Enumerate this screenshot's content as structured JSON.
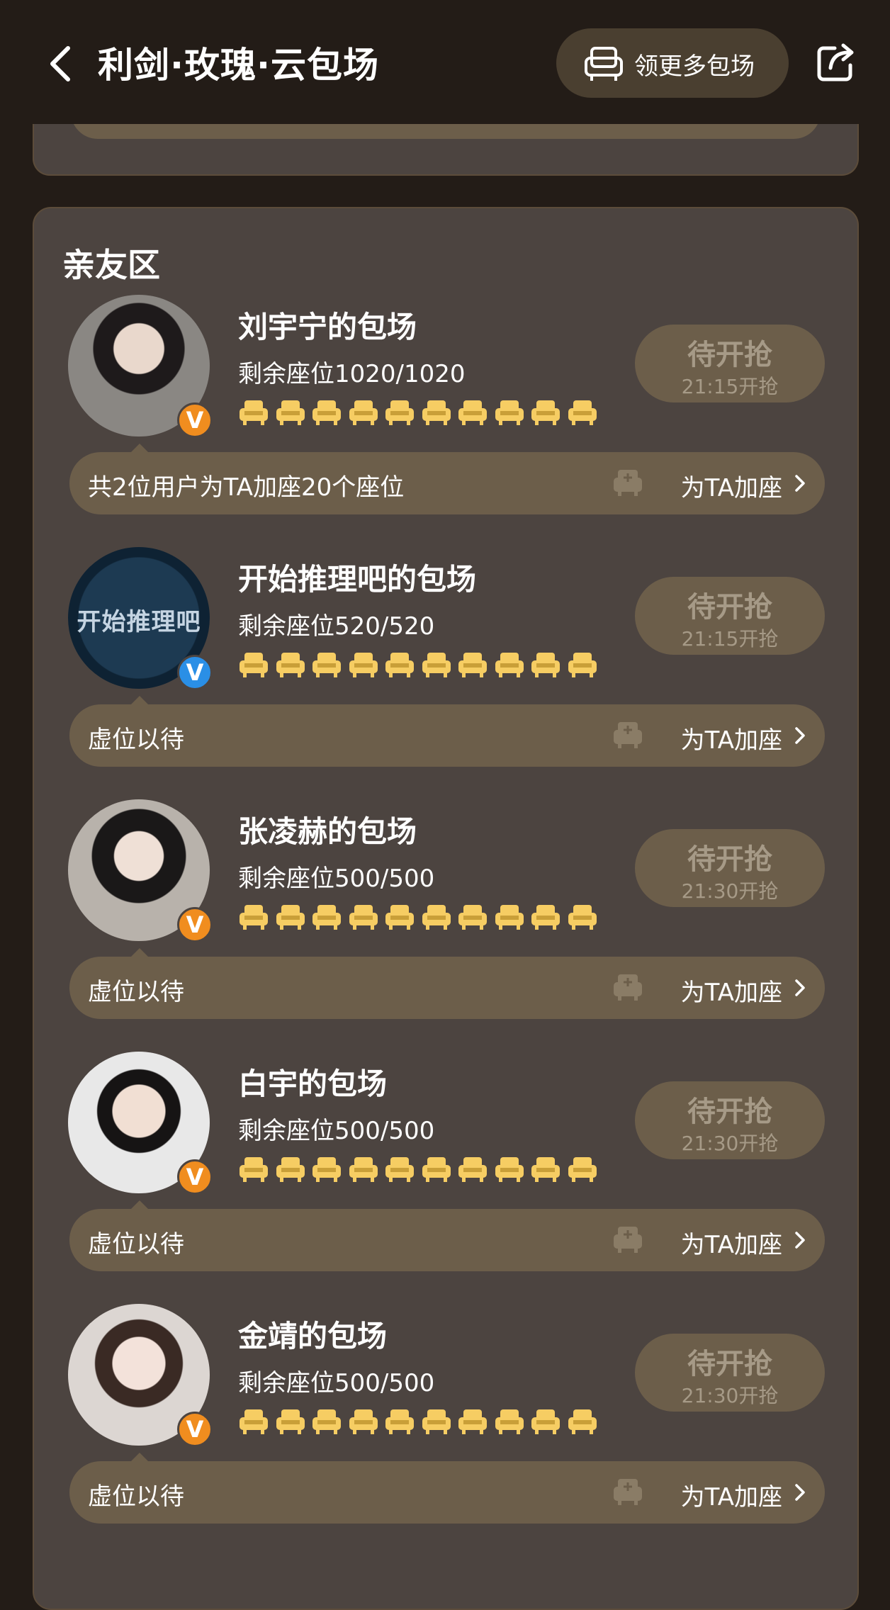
{
  "header": {
    "title": "利剑·玫瑰·云包场",
    "more_button_label": "领更多包场",
    "back_icon": "back-arrow-icon",
    "share_icon": "share-icon"
  },
  "section": {
    "title": "亲友区"
  },
  "colors": {
    "background": "#231c17",
    "card": "#4c4440",
    "pill": "#6c5e4a",
    "seat_gold": "#f6cd63",
    "badge_orange": "#f08d1f",
    "badge_blue": "#2a8fe6"
  },
  "items": [
    {
      "name": "刘宇宁的包场",
      "seats_text": "剩余座位1020/1020",
      "seat_icon_count": 10,
      "status": "待开抢",
      "time": "21:15开抢",
      "bar_text": "共2位用户为TA加座20个座位",
      "add_label": "为TA加座",
      "badge": "V",
      "badge_color": "orange"
    },
    {
      "name": "开始推理吧的包场",
      "seats_text": "剩余座位520/520",
      "seat_icon_count": 10,
      "status": "待开抢",
      "time": "21:15开抢",
      "bar_text": "虚位以待",
      "add_label": "为TA加座",
      "badge": "V",
      "badge_color": "blue",
      "avatar_text": "开始推理吧"
    },
    {
      "name": "张凌赫的包场",
      "seats_text": "剩余座位500/500",
      "seat_icon_count": 10,
      "status": "待开抢",
      "time": "21:30开抢",
      "bar_text": "虚位以待",
      "add_label": "为TA加座",
      "badge": "V",
      "badge_color": "orange"
    },
    {
      "name": "白宇的包场",
      "seats_text": "剩余座位500/500",
      "seat_icon_count": 10,
      "status": "待开抢",
      "time": "21:30开抢",
      "bar_text": "虚位以待",
      "add_label": "为TA加座",
      "badge": "V",
      "badge_color": "orange"
    },
    {
      "name": "金靖的包场",
      "seats_text": "剩余座位500/500",
      "seat_icon_count": 10,
      "status": "待开抢",
      "time": "21:30开抢",
      "bar_text": "虚位以待",
      "add_label": "为TA加座",
      "badge": "V",
      "badge_color": "orange"
    }
  ]
}
